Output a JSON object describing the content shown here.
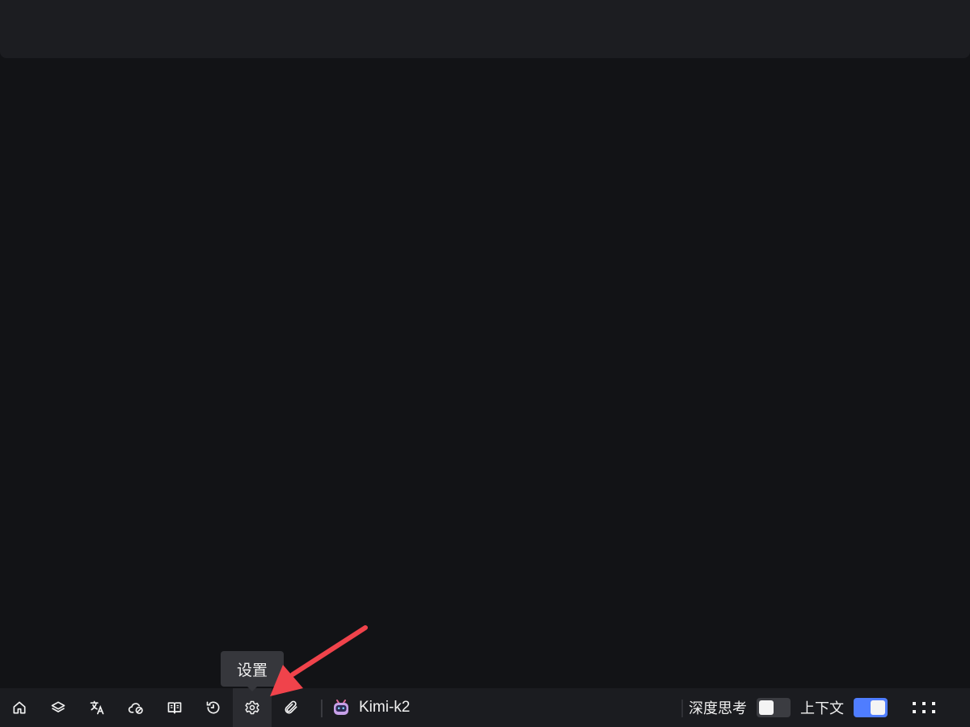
{
  "toolbar": {
    "buttons": [
      {
        "name": "home-button",
        "icon": "home-icon"
      },
      {
        "name": "layers-button",
        "icon": "layers-icon"
      },
      {
        "name": "translate-button",
        "icon": "translate-icon"
      },
      {
        "name": "cloud-off-button",
        "icon": "cloud-off-icon"
      },
      {
        "name": "book-button",
        "icon": "book-icon"
      },
      {
        "name": "history-button",
        "icon": "history-icon"
      },
      {
        "name": "settings-button",
        "icon": "gear-icon",
        "active": true
      },
      {
        "name": "attach-button",
        "icon": "paperclip-icon"
      }
    ],
    "model_label": "Kimi-k2",
    "deep_think_label": "深度思考",
    "deep_think_on": false,
    "context_label": "上下文",
    "context_on": true
  },
  "tooltip": {
    "text": "设置"
  },
  "colors": {
    "background": "#121316",
    "topbar": "#1c1d21",
    "toolbar": "#1b1c20",
    "toggle_off": "#3b3c41",
    "toggle_on": "#4f7dff",
    "annotation_arrow": "#f0434b"
  }
}
